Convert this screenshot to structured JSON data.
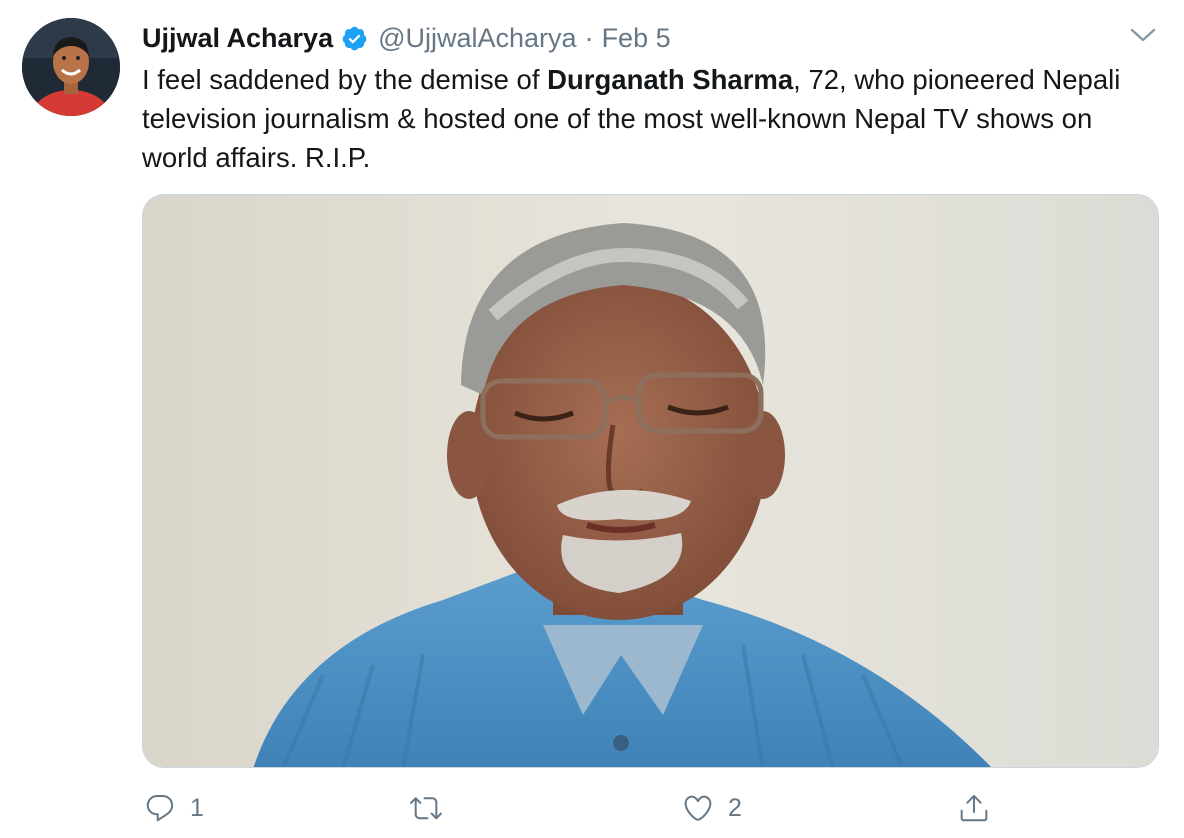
{
  "colors": {
    "text": "#14171a",
    "secondary": "#657786",
    "verified": "#1da1f2",
    "border": "#ccd6dd"
  },
  "author": {
    "name": "Ujjwal Acharya",
    "handle": "@UjjwalAcharya",
    "separator": "·",
    "date": "Feb 5",
    "verified": true
  },
  "tweet": {
    "text_before": "I feel saddened by the demise of ",
    "text_bold": "Durganath Sharma",
    "text_after": ", 72, who pioneered Nepali television journalism & hosted one of the most well-known Nepal TV shows on world affairs. R.I.P."
  },
  "actions": {
    "reply": {
      "icon": "reply-icon",
      "count": "1"
    },
    "retweet": {
      "icon": "retweet-icon",
      "count": ""
    },
    "like": {
      "icon": "heart-icon",
      "count": "2"
    },
    "share": {
      "icon": "share-icon"
    }
  },
  "icons": {
    "menu": "chevron-down-icon",
    "verified": "verified-badge-icon"
  }
}
